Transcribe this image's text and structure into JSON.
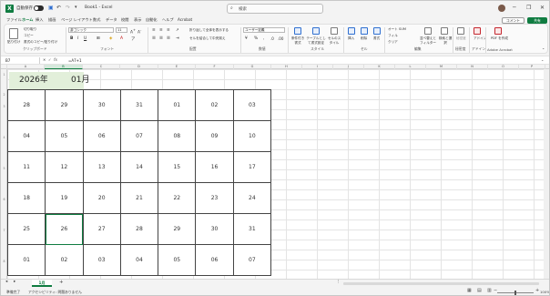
{
  "titlebar": {
    "autosave_label": "自動保存",
    "doc_title": "Book1 - Excel",
    "search_placeholder": "検索",
    "window_controls": [
      "minimize-icon",
      "restore-icon",
      "close-icon"
    ]
  },
  "menu": {
    "tabs": [
      "ファイル",
      "ホーム",
      "挿入",
      "描画",
      "ページ レイアウト",
      "数式",
      "データ",
      "校閲",
      "表示",
      "自動化",
      "ヘルプ",
      "Acrobat"
    ],
    "active_index": 1,
    "comment_label": "コメント",
    "share_label": "共有"
  },
  "ribbon": {
    "groups": [
      "クリップボード",
      "フォント",
      "配置",
      "数値",
      "スタイル",
      "セル",
      "編集",
      "秘密度",
      "アドイン",
      "Adobe Acrobat"
    ],
    "paste_label": "貼り付け",
    "cut_label": "切り取り",
    "copy_label": "コピー",
    "format_painter_label": "書式のコピー/貼り付け",
    "font_name": "游ゴシック",
    "font_size": "11",
    "wrap_label": "折り返して全体を表示する",
    "merge_label": "セルを結合して中央揃え",
    "number_format": "ユーザー定義",
    "cond_format_label": "条件付き書式",
    "table_format_label": "テーブルとして書式設定",
    "cell_style_label": "セルのスタイル",
    "insert_label": "挿入",
    "delete_label": "削除",
    "format_label": "書式",
    "autosum_label": "オート SUM",
    "fill_label": "フィル",
    "clear_label": "クリア",
    "sort_label": "並べ替えとフィルター",
    "find_label": "検索と選択",
    "sensitivity_label": "秘密度",
    "addin_label": "アドイン",
    "pdf_label": "PDF を作成"
  },
  "formula_bar": {
    "name_box": "B7",
    "formula": "=A7+1"
  },
  "columns": [
    "A",
    "B",
    "C",
    "D",
    "E",
    "F",
    "G",
    "H",
    "I",
    "J",
    "K",
    "L",
    "M",
    "N",
    "O",
    "P",
    "Q",
    "R"
  ],
  "selected_column": "B",
  "rows": [
    "1",
    "2",
    "3",
    "4",
    "5",
    "6",
    "7",
    "8",
    "9",
    "10",
    "11",
    "12",
    "13",
    "14",
    "15",
    "16",
    "17",
    "18",
    "19"
  ],
  "header": {
    "year": "2026年",
    "month": "01月"
  },
  "calendar": [
    [
      "28",
      "29",
      "30",
      "31",
      "01",
      "02",
      "03"
    ],
    [
      "04",
      "05",
      "06",
      "07",
      "08",
      "09",
      "10"
    ],
    [
      "11",
      "12",
      "13",
      "14",
      "15",
      "16",
      "17"
    ],
    [
      "18",
      "19",
      "20",
      "21",
      "22",
      "23",
      "24"
    ],
    [
      "25",
      "26",
      "27",
      "28",
      "29",
      "30",
      "31"
    ],
    [
      "01",
      "02",
      "03",
      "04",
      "05",
      "06",
      "07"
    ]
  ],
  "sheet": {
    "tab_name": "1月",
    "add_sheet": "+"
  },
  "status": {
    "ready": "準備完了",
    "accessibility": "アクセシビリティ: 問題ありません",
    "zoom": "100%"
  },
  "colors": {
    "excel_green": "#107c41",
    "header_fill": "#e2efda"
  }
}
